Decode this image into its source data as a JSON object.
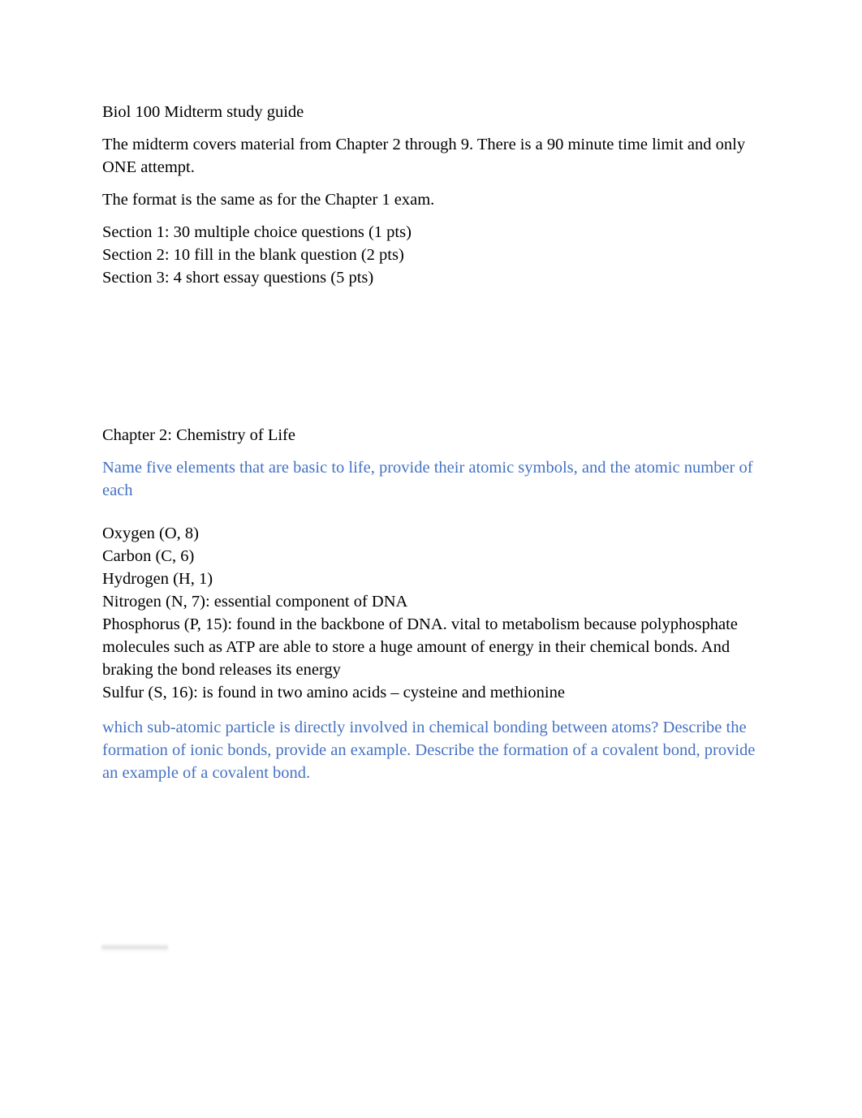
{
  "document": {
    "title": "Biol 100 Midterm study guide",
    "intro_paragraph": "The midterm covers material from Chapter 2 through 9. There is a 90 minute time limit and only ONE attempt.",
    "format_note": "The format is the same as for the Chapter 1 exam.",
    "sections": [
      "Section 1: 30 multiple choice questions (1 pts)",
      "Section 2: 10 fill in the blank question (2 pts)",
      "Section 3: 4 short essay questions (5 pts)"
    ],
    "chapter_heading": "Chapter 2: Chemistry of Life",
    "question_one": "Name five elements that are basic to life, provide their atomic symbols, and the atomic number of each",
    "elements": [
      "Oxygen (O, 8)",
      "Carbon (C, 6)",
      "Hydrogen (H, 1)",
      "Nitrogen (N, 7): essential component of DNA",
      "Phosphorus (P, 15): found in the backbone of DNA. vital to metabolism because polyphosphate molecules such as ATP are able to store a huge amount of energy in their chemical bonds. And braking the bond releases its energy",
      "Sulfur (S, 16): is found in two amino acids – cysteine and methionine"
    ],
    "question_two": "which sub-atomic particle is directly involved in chemical bonding between atoms? Describe the formation of ionic bonds, provide an example. Describe the formation of a covalent bond, provide an example of a covalent bond."
  },
  "colors": {
    "question_blue": "#4472C4",
    "body_text": "#000000",
    "page_background": "#ffffff"
  }
}
